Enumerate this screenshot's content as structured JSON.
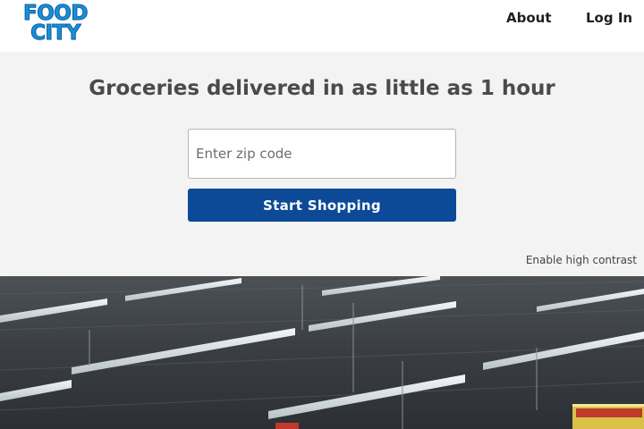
{
  "header": {
    "logo_line1": "FOOD",
    "logo_line2": "CITY",
    "nav": {
      "about": "About",
      "login": "Log In"
    }
  },
  "main": {
    "headline": "Groceries delivered in as little as 1 hour",
    "zip_placeholder": "Enter zip code",
    "zip_value": "",
    "start_button": "Start Shopping",
    "contrast_link": "Enable high contrast"
  },
  "colors": {
    "brand_blue": "#0c4a97",
    "logo_blue": "#1a8fd6",
    "panel_bg": "#f3f3f3"
  }
}
